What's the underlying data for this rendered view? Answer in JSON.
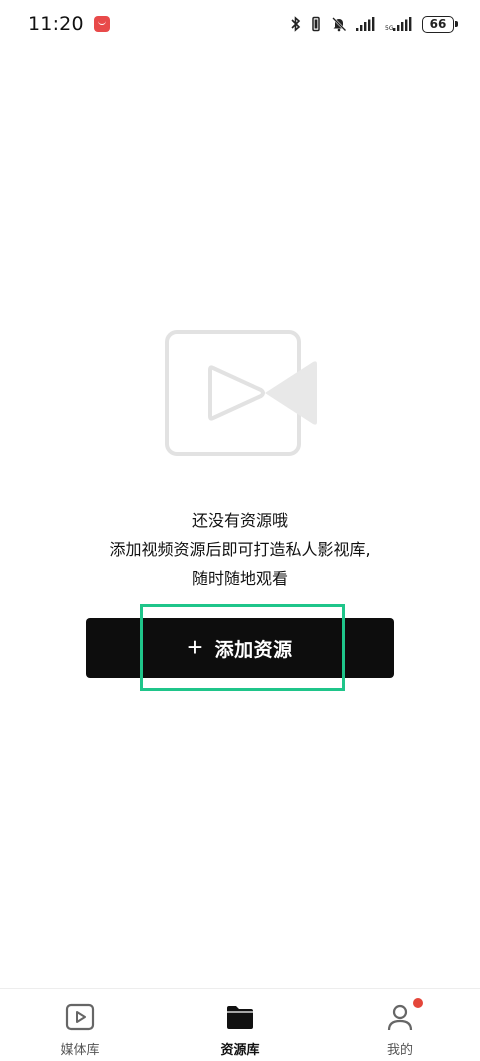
{
  "status_bar": {
    "time": "11:20",
    "battery": "66"
  },
  "empty_state": {
    "line1": "还没有资源哦",
    "line2": "添加视频资源后即可打造私人影视库,",
    "line3": "随时随地观看"
  },
  "add_button": {
    "icon": "plus-icon",
    "label": "添加资源"
  },
  "bottom_nav": {
    "items": [
      {
        "label": "媒体库",
        "icon": "play-square-icon",
        "active": false
      },
      {
        "label": "资源库",
        "icon": "folder-icon",
        "active": true
      },
      {
        "label": "我的",
        "icon": "person-icon",
        "active": false,
        "badge": true
      }
    ]
  },
  "colors": {
    "accent": "#1fc58a",
    "button_bg": "#0d0d0d",
    "badge": "#e4463a"
  }
}
